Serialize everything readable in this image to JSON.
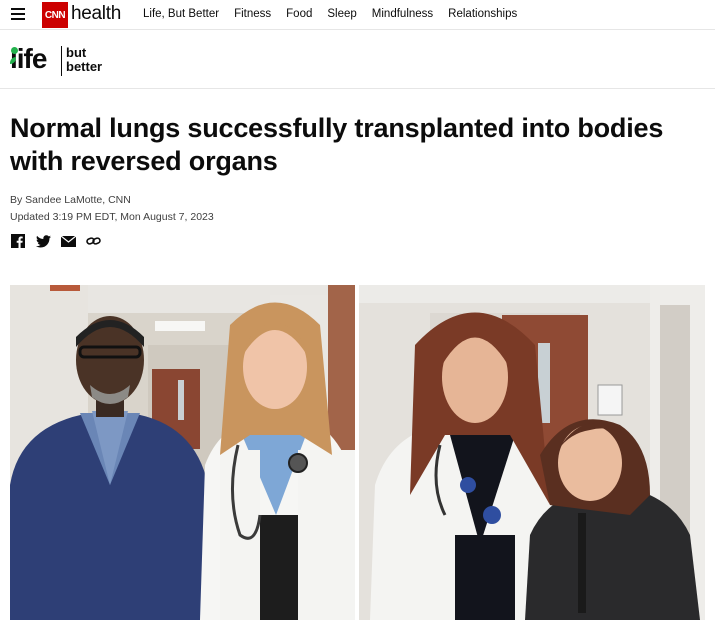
{
  "topnav": {
    "logo_text": "CNN",
    "section_name": "health",
    "links": [
      "Life, But Better",
      "Fitness",
      "Food",
      "Sleep",
      "Mindfulness",
      "Relationships"
    ]
  },
  "subbrand": {
    "logo_word": "life",
    "logo_tag_line1": "but",
    "logo_tag_line2": "better"
  },
  "article": {
    "headline": "Normal lungs successfully transplanted into bodies with reversed organs",
    "byline": "By Sandee LaMotte, CNN",
    "timestamp": "Updated 3:19 PM EDT, Mon August 7, 2023"
  },
  "share_icons": [
    "facebook-icon",
    "twitter-icon",
    "email-icon",
    "link-icon"
  ],
  "colors": {
    "brand_red": "#cc0000",
    "lbb_green": "#22b14c",
    "text": "#0c0c0c",
    "meta_text": "#404040"
  }
}
